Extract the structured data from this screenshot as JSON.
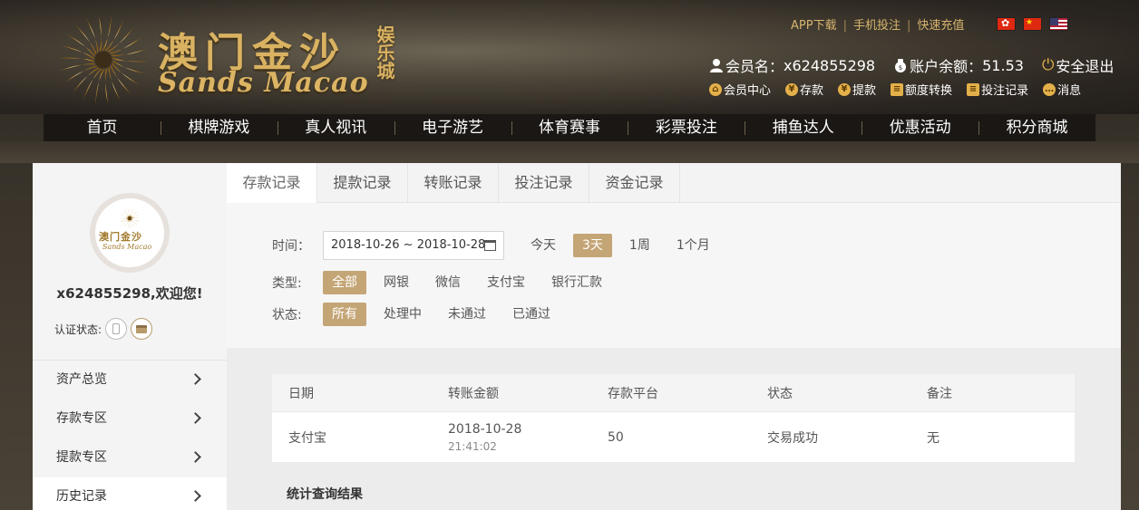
{
  "header": {
    "logo": {
      "cn": "澳门金沙",
      "en": "Sands Macao",
      "side": "娱乐城"
    },
    "toplinks": [
      "APP下载",
      "手机投注",
      "快速充值"
    ],
    "flags": [
      "hk-flag",
      "cn-flag",
      "us-flag"
    ],
    "user": {
      "member_label": "会员名：",
      "member_value": "x624855298",
      "balance_label": "账户余额：",
      "balance_value": "51.53",
      "logout": "安全退出"
    },
    "sublinks": [
      {
        "label": "会员中心",
        "icon": "home-icon"
      },
      {
        "label": "存款",
        "icon": "yen-icon"
      },
      {
        "label": "提款",
        "icon": "yen-icon"
      },
      {
        "label": "额度转换",
        "icon": "transfer-icon"
      },
      {
        "label": "投注记录",
        "icon": "record-icon"
      },
      {
        "label": "消息",
        "icon": "message-icon"
      }
    ]
  },
  "nav": [
    "首页",
    "棋牌游戏",
    "真人视讯",
    "电子游艺",
    "体育赛事",
    "彩票投注",
    "捕鱼达人",
    "优惠活动",
    "积分商城"
  ],
  "sidebar": {
    "welcome": "x624855298,欢迎您!",
    "verify_label": "认证状态:",
    "menu": [
      "资产总览",
      "存款专区",
      "提款专区",
      "历史记录"
    ],
    "active_menu": "历史记录"
  },
  "tabs": [
    "存款记录",
    "提款记录",
    "转账记录",
    "投注记录",
    "资金记录"
  ],
  "active_tab": "存款记录",
  "filters": {
    "time_label": "时间：",
    "date_range": "2018-10-26 ~ 2018-10-28",
    "time_options": [
      "今天",
      "3天",
      "1周",
      "1个月"
    ],
    "time_selected": "3天",
    "type_label": "类型:",
    "type_options": [
      "全部",
      "网银",
      "微信",
      "支付宝",
      "银行汇款"
    ],
    "type_selected": "全部",
    "status_label": "状态:",
    "status_options": [
      "所有",
      "处理中",
      "未通过",
      "已通过"
    ],
    "status_selected": "所有"
  },
  "table": {
    "headers": [
      "日期",
      "转账金额",
      "存款平台",
      "状态",
      "备注"
    ],
    "rows": [
      {
        "col1": "支付宝",
        "date": "2018-10-28",
        "time": "21:41:02",
        "platform": "50",
        "status": "交易成功",
        "note": "无"
      }
    ]
  },
  "summary": "统计查询结果",
  "colors": {
    "gold": "#c4a576",
    "nav_bg": "#1a1714",
    "accent": "#d9b262"
  }
}
